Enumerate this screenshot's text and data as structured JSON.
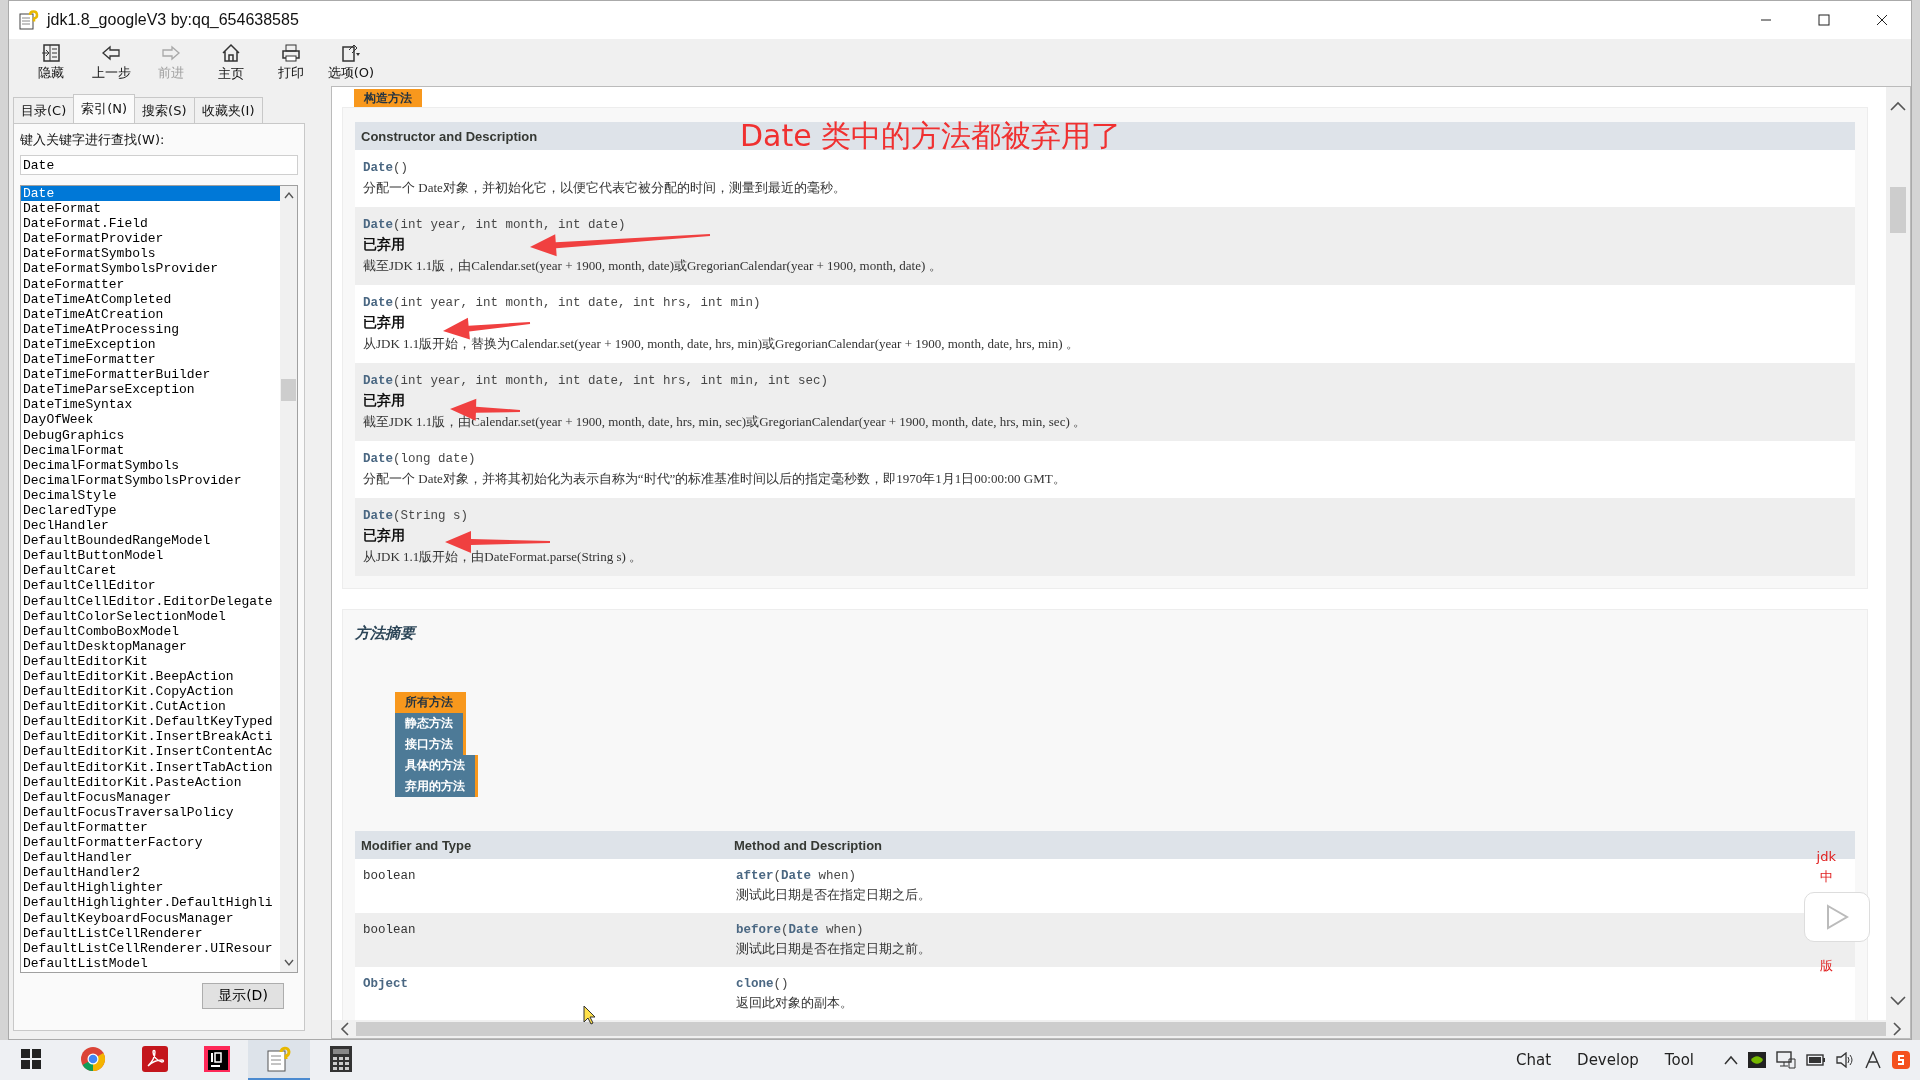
{
  "window": {
    "title": "jdk1.8_googleV3 by:qq_654638585"
  },
  "toolbar": [
    {
      "label": "隐藏",
      "kind": "hide",
      "disabled": false
    },
    {
      "label": "上一步",
      "kind": "back",
      "disabled": false
    },
    {
      "label": "前进",
      "kind": "forward",
      "disabled": true
    },
    {
      "label": "主页",
      "kind": "home",
      "disabled": false
    },
    {
      "label": "打印",
      "kind": "print",
      "disabled": false
    },
    {
      "label": "选项(O)",
      "kind": "options",
      "disabled": false
    }
  ],
  "nav_tabs": [
    {
      "label": "目录(C)",
      "selected": false
    },
    {
      "label": "索引(N)",
      "selected": true
    },
    {
      "label": "搜索(S)",
      "selected": false
    },
    {
      "label": "收藏夹(I)",
      "selected": false
    }
  ],
  "search": {
    "label": "键入关键字进行查找(W):",
    "value": "Date"
  },
  "index_list": [
    {
      "label": "Date",
      "selected": true
    },
    {
      "label": "DateFormat",
      "selected": false
    },
    {
      "label": "DateFormat.Field",
      "selected": false
    },
    {
      "label": "DateFormatProvider",
      "selected": false
    },
    {
      "label": "DateFormatSymbols",
      "selected": false
    },
    {
      "label": "DateFormatSymbolsProvider",
      "selected": false
    },
    {
      "label": "DateFormatter",
      "selected": false
    },
    {
      "label": "DateTimeAtCompleted",
      "selected": false
    },
    {
      "label": "DateTimeAtCreation",
      "selected": false
    },
    {
      "label": "DateTimeAtProcessing",
      "selected": false
    },
    {
      "label": "DateTimeException",
      "selected": false
    },
    {
      "label": "DateTimeFormatter",
      "selected": false
    },
    {
      "label": "DateTimeFormatterBuilder",
      "selected": false
    },
    {
      "label": "DateTimeParseException",
      "selected": false
    },
    {
      "label": "DateTimeSyntax",
      "selected": false
    },
    {
      "label": "DayOfWeek",
      "selected": false
    },
    {
      "label": "DebugGraphics",
      "selected": false
    },
    {
      "label": "DecimalFormat",
      "selected": false
    },
    {
      "label": "DecimalFormatSymbols",
      "selected": false
    },
    {
      "label": "DecimalFormatSymbolsProvider",
      "selected": false
    },
    {
      "label": "DecimalStyle",
      "selected": false
    },
    {
      "label": "DeclaredType",
      "selected": false
    },
    {
      "label": "DeclHandler",
      "selected": false
    },
    {
      "label": "DefaultBoundedRangeModel",
      "selected": false
    },
    {
      "label": "DefaultButtonModel",
      "selected": false
    },
    {
      "label": "DefaultCaret",
      "selected": false
    },
    {
      "label": "DefaultCellEditor",
      "selected": false
    },
    {
      "label": "DefaultCellEditor.EditorDelegate",
      "selected": false
    },
    {
      "label": "DefaultColorSelectionModel",
      "selected": false
    },
    {
      "label": "DefaultComboBoxModel",
      "selected": false
    },
    {
      "label": "DefaultDesktopManager",
      "selected": false
    },
    {
      "label": "DefaultEditorKit",
      "selected": false
    },
    {
      "label": "DefaultEditorKit.BeepAction",
      "selected": false
    },
    {
      "label": "DefaultEditorKit.CopyAction",
      "selected": false
    },
    {
      "label": "DefaultEditorKit.CutAction",
      "selected": false
    },
    {
      "label": "DefaultEditorKit.DefaultKeyTyped",
      "selected": false
    },
    {
      "label": "DefaultEditorKit.InsertBreakActi",
      "selected": false
    },
    {
      "label": "DefaultEditorKit.InsertContentAc",
      "selected": false
    },
    {
      "label": "DefaultEditorKit.InsertTabAction",
      "selected": false
    },
    {
      "label": "DefaultEditorKit.PasteAction",
      "selected": false
    },
    {
      "label": "DefaultFocusManager",
      "selected": false
    },
    {
      "label": "DefaultFocusTraversalPolicy",
      "selected": false
    },
    {
      "label": "DefaultFormatter",
      "selected": false
    },
    {
      "label": "DefaultFormatterFactory",
      "selected": false
    },
    {
      "label": "DefaultHandler",
      "selected": false
    },
    {
      "label": "DefaultHandler2",
      "selected": false
    },
    {
      "label": "DefaultHighlighter",
      "selected": false
    },
    {
      "label": "DefaultHighlighter.DefaultHighli",
      "selected": false
    },
    {
      "label": "DefaultKeyboardFocusManager",
      "selected": false
    },
    {
      "label": "DefaultListCellRenderer",
      "selected": false
    },
    {
      "label": "DefaultListCellRenderer.UIResour",
      "selected": false
    },
    {
      "label": "DefaultListModel",
      "selected": false
    }
  ],
  "display_button": "显示(D)",
  "constructors": {
    "tab": "构造方法",
    "header": "Constructor and Description",
    "annotation": "Date 类中的方法都被弃用了",
    "rows": [
      {
        "signature": "**Date**()",
        "description": "分配一个 Date对象，并初始化它，以便它代表它被分配的时间，测量到最近的毫秒。",
        "arrow": false
      },
      {
        "signature": "**Date**(int year, int month, int date)",
        "deprecated": "已弃用",
        "description": "截至JDK 1.1版，由Calendar.set(year + 1900, month, date)或GregorianCalendar(year + 1900, month, date) 。",
        "arrow": true
      },
      {
        "signature": "**Date**(int year, int month, int date, int hrs, int min)",
        "deprecated": "已弃用",
        "description": "从JDK 1.1版开始，替换为Calendar.set(year + 1900, month, date, hrs, min)或GregorianCalendar(year + 1900, month, date, hrs, min) 。",
        "arrow": true
      },
      {
        "signature": "**Date**(int year, int month, int date, int hrs, int min, int sec)",
        "deprecated": "已弃用",
        "description": "截至JDK 1.1版，由Calendar.set(year + 1900, month, date, hrs, min, sec)或GregorianCalendar(year + 1900, month, date, hrs, min, sec) 。",
        "arrow": true
      },
      {
        "signature": "**Date**(long date)",
        "description": "分配一个 Date对象，并将其初始化为表示自称为“时代”的标准基准时间以后的指定毫秒数，即1970年1月1日00:00:00 GMT。",
        "arrow": false
      },
      {
        "signature": "**Date**(String s)",
        "deprecated": "已弃用",
        "description": "从JDK 1.1版开始，由DateFormat.parse(String s) 。",
        "arrow": true
      }
    ]
  },
  "method_summary": {
    "title": "方法摘要",
    "tabs": [
      {
        "label": "所有方法",
        "selected": true
      },
      {
        "label": "静态方法",
        "selected": false
      },
      {
        "label": "接口方法",
        "selected": false
      },
      {
        "label": "具体的方法",
        "selected": false
      },
      {
        "label": "弃用的方法",
        "selected": false
      }
    ],
    "columns": [
      "Modifier and Type",
      "Method and Description"
    ],
    "rows": [
      {
        "type": "boolean",
        "type_link": false,
        "signature": "**after**(**Date** when)",
        "description": "测试此日期是否在指定日期之后。"
      },
      {
        "type": "boolean",
        "type_link": false,
        "signature": "**before**(**Date** when)",
        "description": "测试此日期是否在指定日期之前。"
      },
      {
        "type": "Object",
        "type_link": true,
        "signature": "**clone**()",
        "description": "返回此对象的副本。"
      }
    ]
  },
  "side_label": {
    "top": "jdk",
    "middle": "中",
    "bottom": "版"
  },
  "taskbar": {
    "apps": [
      {
        "kind": "start",
        "selected": false
      },
      {
        "kind": "chrome",
        "selected": false
      },
      {
        "kind": "acrobat",
        "selected": false
      },
      {
        "kind": "intellij",
        "selected": false
      },
      {
        "kind": "help",
        "selected": true
      },
      {
        "kind": "calculator",
        "selected": false
      }
    ],
    "labels": [
      "Chat",
      "Develop",
      "Tool"
    ],
    "tray": [
      {
        "kind": "caret"
      },
      {
        "kind": "nvidia"
      },
      {
        "kind": "network"
      },
      {
        "kind": "battery"
      },
      {
        "kind": "volume"
      },
      {
        "kind": "ime"
      },
      {
        "kind": "app"
      }
    ]
  }
}
